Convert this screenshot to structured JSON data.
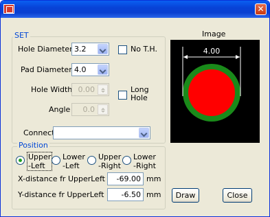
{
  "window": {
    "close_glyph": "✕"
  },
  "set": {
    "title": "SET",
    "hole_diameter": {
      "label": "Hole Diameter",
      "value": "3.2"
    },
    "no_th": {
      "label": "No T.H.",
      "checked": false
    },
    "pad_diameter": {
      "label": "Pad Diameter",
      "value": "4.0"
    },
    "hole_width": {
      "label": "Hole Width",
      "value": "0.00"
    },
    "long_hole": {
      "label_line1": "Long",
      "label_line2": "Hole",
      "checked": false
    },
    "angle": {
      "label": "Angle",
      "value": "0.0"
    },
    "connect_net": {
      "label": "Connect Net",
      "value": ""
    }
  },
  "position": {
    "title": "Position",
    "options": [
      {
        "line1": "Upper",
        "line2": "-Left",
        "selected": true
      },
      {
        "line1": "Lower",
        "line2": "-Left",
        "selected": false
      },
      {
        "line1": "Upper",
        "line2": "-Right",
        "selected": false
      },
      {
        "line1": "Lower",
        "line2": "-Right",
        "selected": false
      }
    ],
    "x_distance": {
      "label": "X-distance fr UpperLeft",
      "value": "-69.00",
      "unit": "mm"
    },
    "y_distance": {
      "label": "Y-distance fr UpperLeft",
      "value": "-6.50",
      "unit": "mm"
    }
  },
  "image": {
    "title": "Image",
    "dimension_label": "4.00",
    "colors": {
      "background": "#000000",
      "pad": "#1a8a1a",
      "hole": "#ff0000",
      "dimension": "#ffffff"
    }
  },
  "buttons": {
    "draw": "Draw",
    "close": "Close"
  }
}
